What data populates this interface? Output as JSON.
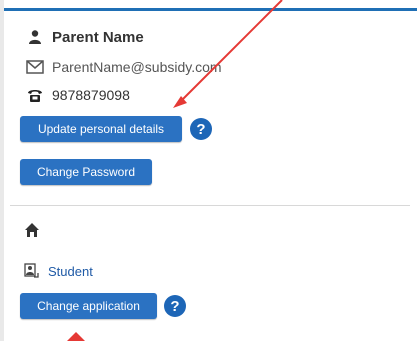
{
  "profile": {
    "name": "Parent Name",
    "email": "ParentName@subsidy.com",
    "phone": "9878879098"
  },
  "buttons": {
    "update_details": "Update personal details",
    "change_password": "Change Password",
    "change_application": "Change application"
  },
  "help_label": "?",
  "student": {
    "label": "Student"
  },
  "colors": {
    "accent": "#2b72c2",
    "help": "#1d66b7",
    "annotation_arrow": "#e53935"
  },
  "icons": {
    "name": "user-icon",
    "email": "envelope-icon",
    "phone": "telephone-icon",
    "home": "home-icon",
    "student": "student-icon"
  }
}
